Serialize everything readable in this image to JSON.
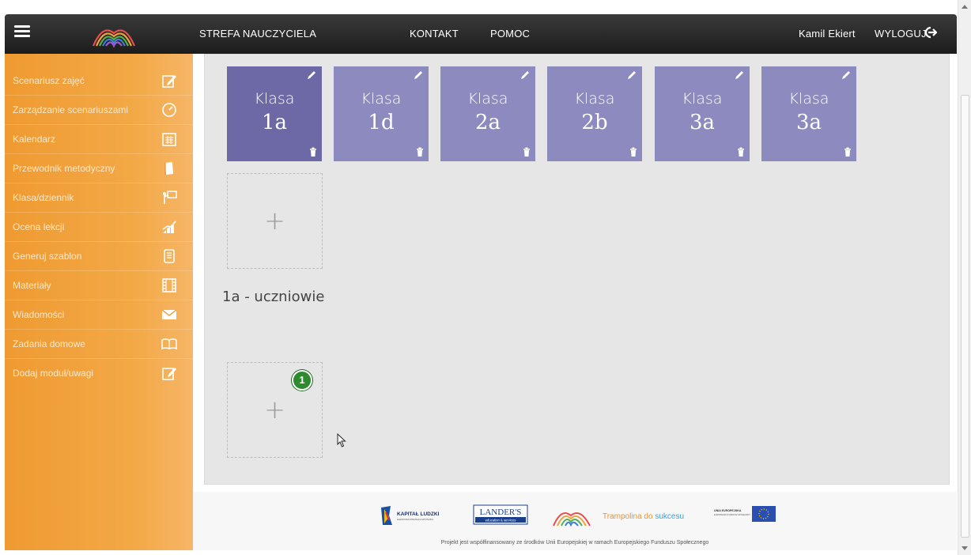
{
  "topbar": {
    "menu_icon": "hamburger-icon",
    "nav": [
      "STREFA NAUCZYCIELA",
      "KONTAKT",
      "POMOC"
    ],
    "user_name": "Kamil Ekiert",
    "logout_label": "WYLOGUJ",
    "logout_icon": "logout-icon"
  },
  "sidebar": {
    "items": [
      {
        "label": "Scenariusz zajęć",
        "icon": "edit-icon"
      },
      {
        "label": "Zarządzanie scenariuszami",
        "icon": "gauge-icon"
      },
      {
        "label": "Kalendarz",
        "icon": "calendar-icon"
      },
      {
        "label": "Przewodnik metodyczny",
        "icon": "book-icon"
      },
      {
        "label": "Klasa/dziennik",
        "icon": "teacher-board-icon"
      },
      {
        "label": "Ocena lekcji",
        "icon": "chart-icon"
      },
      {
        "label": "Generuj szablon",
        "icon": "document-icon"
      },
      {
        "label": "Materiały",
        "icon": "film-icon"
      },
      {
        "label": "Wiadomości",
        "icon": "envelope-icon"
      },
      {
        "label": "Zadania domowe",
        "icon": "open-book-icon"
      },
      {
        "label": "Dodaj moduł/uwagi",
        "icon": "note-edit-icon"
      }
    ]
  },
  "classes": [
    {
      "word": "Klasa",
      "name": "1a",
      "active": true
    },
    {
      "word": "Klasa",
      "name": "1d",
      "active": false
    },
    {
      "word": "Klasa",
      "name": "2a",
      "active": false
    },
    {
      "word": "Klasa",
      "name": "2b",
      "active": false
    },
    {
      "word": "Klasa",
      "name": "3a",
      "active": false
    },
    {
      "word": "Klasa",
      "name": "3a",
      "active": false
    }
  ],
  "add_class": {
    "symbol": "+"
  },
  "students": {
    "title": "1a - uczniowie",
    "add_symbol": "+",
    "badge": "1"
  },
  "footer": {
    "logos": [
      "KAPITAŁ LUDZKI",
      "LANDER'S",
      "Trampolina do sukcesu",
      "UNIA EUROPEJSKA"
    ],
    "kapital_sub": "NARODOWA STRATEGIA SPÓJNOŚCI",
    "landers_sub": "education & services",
    "trampolina_a": "Trampolina do ",
    "trampolina_b": "sukcesu",
    "ue_sub": "EUROPEJSKI FUNDUSZ SPOŁECZNY",
    "note": "Projekt jest współfinansowany ze środków Unii Europejskiej w ramach Europejskiego Funduszu Społecznego"
  },
  "colors": {
    "topbar": "#2b2b2b",
    "sidebar": "#f3a947",
    "class_tile": "#8d8ac0",
    "class_tile_active": "#6c69a6",
    "badge": "#2d8a2d"
  }
}
